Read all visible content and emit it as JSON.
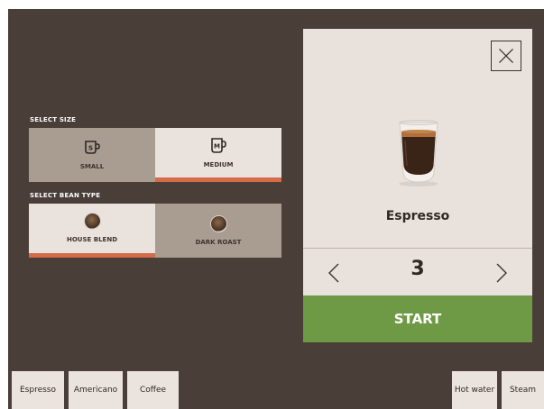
{
  "size_section": {
    "label": "SELECT SIZE",
    "options": [
      {
        "label": "SMALL",
        "icon": "cup-small-icon",
        "selected": false
      },
      {
        "label": "MEDIUM",
        "icon": "cup-medium-icon",
        "selected": true
      }
    ]
  },
  "bean_section": {
    "label": "SELECT BEAN TYPE",
    "options": [
      {
        "label": "HOUSE BLEND",
        "icon": "bean-icon",
        "selected": true
      },
      {
        "label": "DARK ROAST",
        "icon": "bean-icon",
        "selected": false
      }
    ]
  },
  "panel": {
    "drink_name": "Espresso",
    "quantity": "3",
    "start_label": "START",
    "close_icon": "close-icon",
    "prev_icon": "chevron-left-icon",
    "next_icon": "chevron-right-icon"
  },
  "bottom_bar": {
    "left": [
      "Espresso",
      "Americano",
      "Coffee"
    ],
    "right": [
      "Hot water",
      "Steam"
    ]
  },
  "colors": {
    "background": "#4a3e39",
    "accent": "#d56b49",
    "start": "#6f9a45",
    "panel": "#e9e1dc"
  }
}
